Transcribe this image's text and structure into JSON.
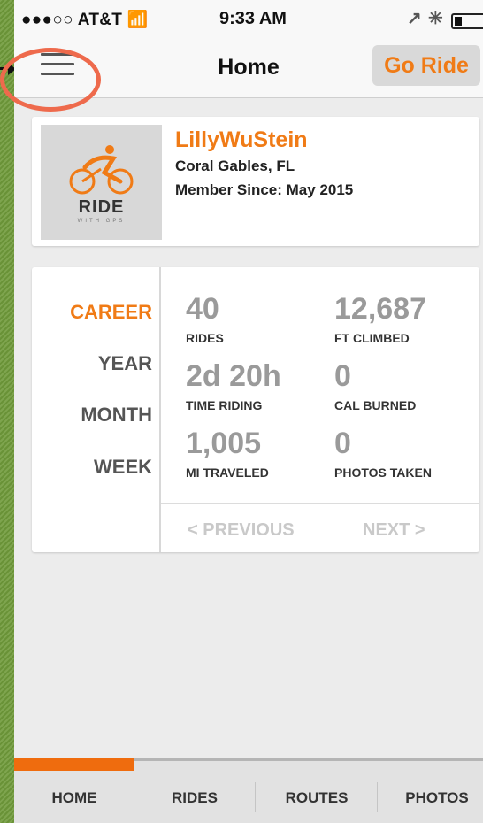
{
  "status_bar": {
    "carrier": "●●●○○ AT&T",
    "wifi_icon": "wifi",
    "time": "9:33 AM",
    "icons": [
      "location-arrow",
      "bluetooth",
      "battery"
    ]
  },
  "nav": {
    "menu_icon": "hamburger-menu",
    "title": "Home",
    "go_ride_label": "Go Ride"
  },
  "profile": {
    "logo_text": "RIDE",
    "logo_subtext": "WITH GPS",
    "name": "LillyWuStein",
    "location": "Coral Gables, FL",
    "member_since": "Member Since: May 2015"
  },
  "stats": {
    "periods": [
      {
        "label": "CAREER",
        "active": true
      },
      {
        "label": "YEAR",
        "active": false
      },
      {
        "label": "MONTH",
        "active": false
      },
      {
        "label": "WEEK",
        "active": false
      }
    ],
    "items": [
      {
        "value": "40",
        "label": "RIDES"
      },
      {
        "value": "12,687",
        "label": "FT CLIMBED"
      },
      {
        "value": "2d 20h",
        "label": "TIME RIDING"
      },
      {
        "value": "0",
        "label": "CAL BURNED"
      },
      {
        "value": "1,005",
        "label": "MI TRAVELED"
      },
      {
        "value": "0",
        "label": "PHOTOS TAKEN"
      }
    ],
    "previous_label": "< PREVIOUS",
    "next_label": "NEXT >"
  },
  "tabs": [
    {
      "label": "HOME",
      "active": true
    },
    {
      "label": "RIDES",
      "active": false
    },
    {
      "label": "ROUTES",
      "active": false
    },
    {
      "label": "PHOTOS",
      "active": false
    }
  ],
  "colors": {
    "accent": "#f07b16",
    "annotation_ring": "#ee6a4c",
    "background_green": "#6f9a3a"
  }
}
